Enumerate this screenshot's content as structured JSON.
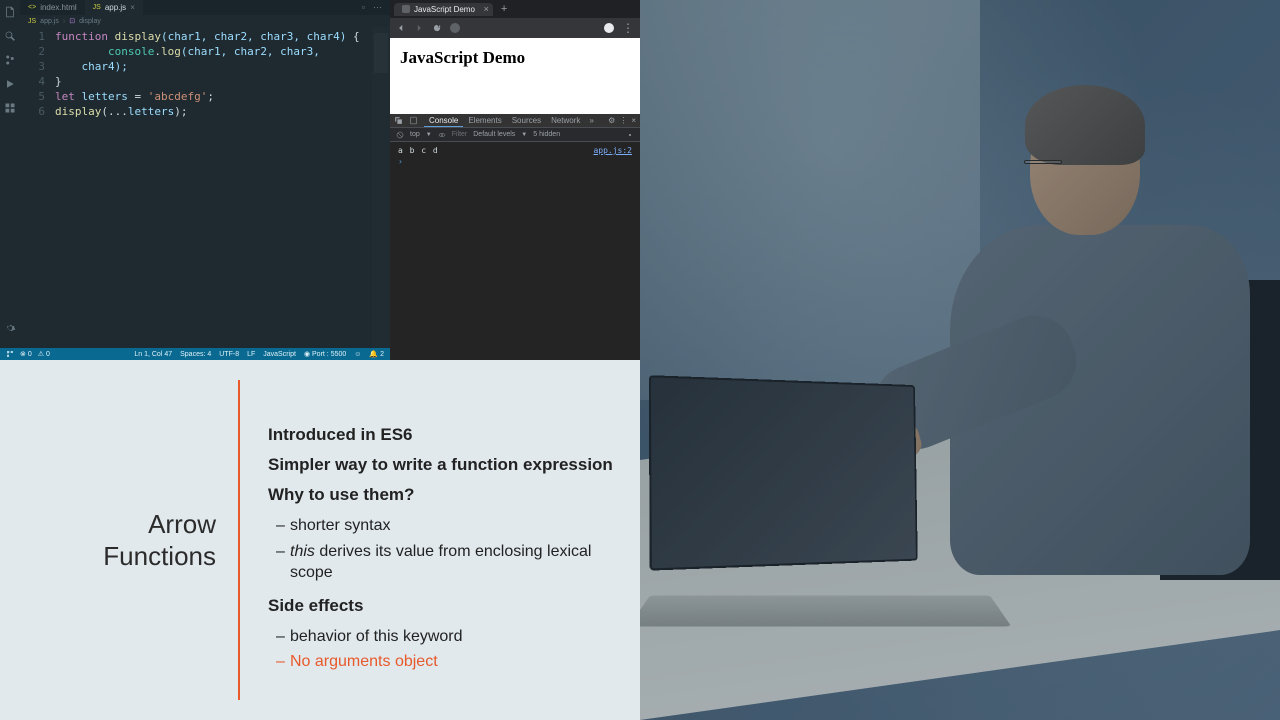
{
  "editor": {
    "tabs": [
      {
        "icon": "html-icon",
        "label": "index.html",
        "active": false
      },
      {
        "icon": "js-icon",
        "label": "app.js",
        "active": true
      }
    ],
    "breadcrumb": [
      "app.js",
      "display"
    ],
    "lines": [
      "1",
      "2",
      "3",
      "4",
      "5",
      "6"
    ],
    "code": {
      "l1": {
        "kw": "function",
        "fn": "display",
        "params": "(char1, char2, char3, char4)",
        "brace": " {"
      },
      "l2": {
        "indent": "        ",
        "obj": "console",
        "dot": ".",
        "meth": "log",
        "args": "(char1, char2, char3,",
        "cont_indent": "    ",
        "cont": "char4);"
      },
      "l3": "}",
      "l4": {
        "kw": "let",
        "var": "letters",
        "eq": " = ",
        "str": "'abcdefg'",
        "semi": ";"
      },
      "l5": {
        "fn": "display",
        "open": "(",
        "spread": "...",
        "var": "letters",
        "close": ");"
      }
    },
    "status": {
      "branch_icon": "git-branch",
      "errors": "0",
      "warnings": "0",
      "cursor": "Ln 1, Col 47",
      "spaces": "Spaces: 4",
      "encoding": "UTF-8",
      "eol": "LF",
      "language": "JavaScript",
      "port": "Port : 5500",
      "notifications": "2"
    }
  },
  "browser": {
    "tab_title": "JavaScript Demo",
    "page_heading": "JavaScript Demo",
    "devtools": {
      "tabs": [
        "Console",
        "Elements",
        "Sources",
        "Network"
      ],
      "active_tab": "Console",
      "filter_context": "top",
      "filter_placeholder": "Filter",
      "levels": "Default levels",
      "hidden": "5 hidden",
      "console_output": "a b c d",
      "console_source": "app.js:2"
    }
  },
  "slide": {
    "title_line1": "Arrow",
    "title_line2": "Functions",
    "point1": "Introduced in ES6",
    "point2": "Simpler way to write a function expression",
    "heading1": "Why to use them?",
    "bullets1": [
      "shorter syntax",
      {
        "ital": "this",
        "rest": " derives its value from enclosing lexical scope"
      }
    ],
    "heading2": "Side effects",
    "bullets2": [
      {
        "text": "behavior of this keyword",
        "highlight": false
      },
      {
        "text": "No arguments object",
        "highlight": true
      }
    ]
  }
}
